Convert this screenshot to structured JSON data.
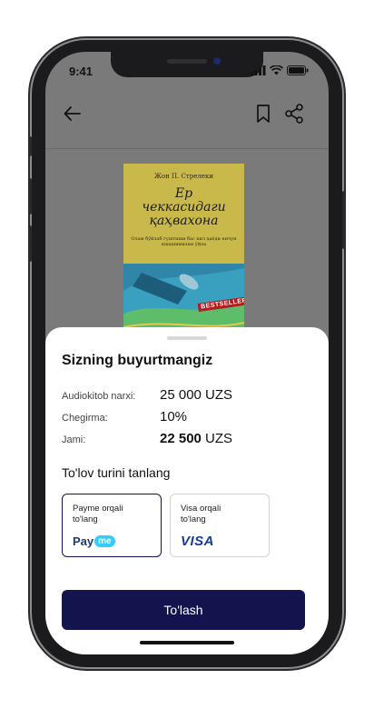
{
  "status": {
    "time": "9:41"
  },
  "header": {
    "back_icon": "arrow-left-icon",
    "bookmark_icon": "bookmark-icon",
    "share_icon": "share-icon"
  },
  "book": {
    "author": "Жон П. Стрелеки",
    "title_line1": "Ер",
    "title_line2": "чеккасидаги",
    "title_line3": "қаҳвахона",
    "subtitle": "Олам бўйлаб гуштиши бас кил ҳаёди ничун яшашимизни ўйла",
    "badge": "BESTSELLER"
  },
  "order": {
    "title": "Sizning buyurtmangiz",
    "rows": [
      {
        "label": "Audiokitob narxi:",
        "value": "25 000 UZS"
      },
      {
        "label": "Chegirma:",
        "value": "10%"
      },
      {
        "label": "Jami:",
        "value_bold": "22 500",
        "value_rest": " UZS"
      }
    ]
  },
  "payment": {
    "section_title": "To'lov turini tanlang",
    "options": [
      {
        "label_line1": "Payme orqali",
        "label_line2": "to'lang",
        "logo_text_a": "Pay",
        "logo_text_b": "me",
        "selected": true
      },
      {
        "label_line1": "Visa orqali",
        "label_line2": "to'lang",
        "logo_text": "VISA",
        "selected": false
      }
    ],
    "submit_label": "To'lash"
  },
  "colors": {
    "primary": "#13134e",
    "payme_blue": "#33ccff",
    "visa_blue": "#1a3a9a"
  }
}
